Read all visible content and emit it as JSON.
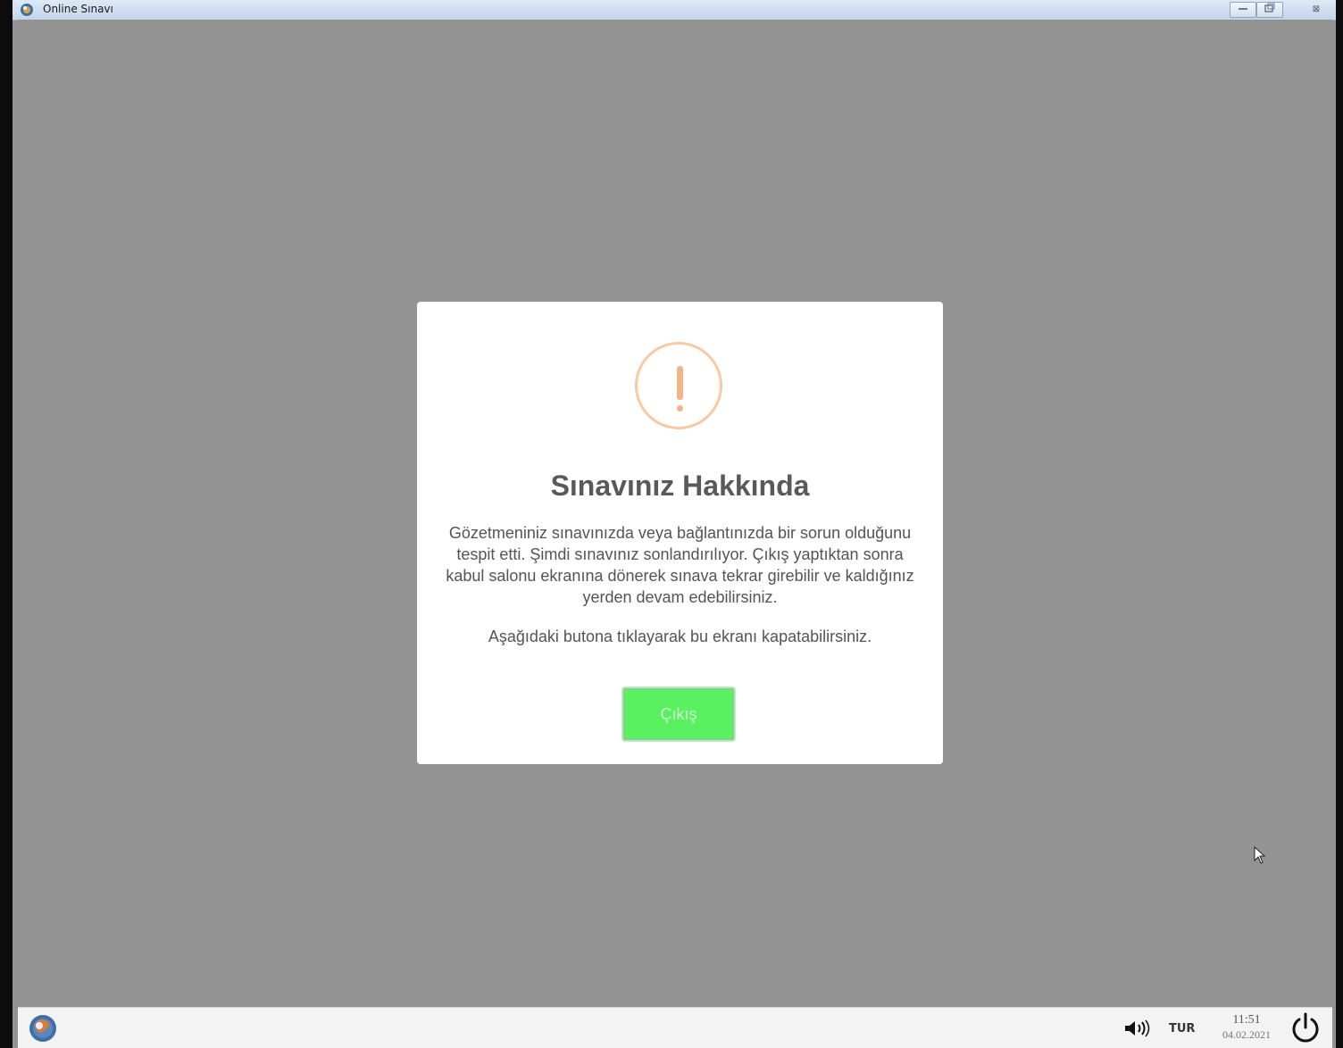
{
  "window": {
    "title": "Online Sınavı"
  },
  "controls": {
    "minimize_label": "",
    "maximize_label": "",
    "close_label": "⊠"
  },
  "dialog": {
    "title": "Sınavınız Hakkında",
    "message": "Gözetmeniniz sınavınızda veya bağlantınızda bir sorun olduğunu tespit etti. Şimdi sınavınız sonlandırılıyor. Çıkış yaptıktan sonra kabul salonu ekranına dönerek sınava tekrar girebilir ve kaldığınız yerden devam edebilirsiniz.",
    "instruction": "Aşağıdaki butona tıklayarak bu ekranı kapatabilirsiniz.",
    "exit_button_label": "Çıkış",
    "icon": "warning-exclamation-icon",
    "icon_color": "#f3b487",
    "button_color": "#59f15f"
  },
  "taskbar": {
    "language": "TUR",
    "time": "11:51",
    "date": "04.02.2021"
  }
}
